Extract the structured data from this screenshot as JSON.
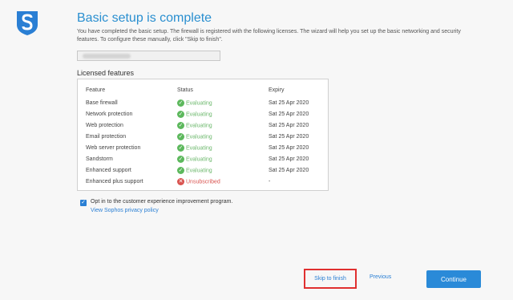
{
  "header": {
    "title": "Basic setup is complete",
    "intro": "You have completed the basic setup. The firewall is registered with the following licenses. The wizard will help you set up the basic networking and security features. To configure these manually, click \"Skip to finish\"."
  },
  "hostname": {
    "value": ""
  },
  "licenses": {
    "heading": "Licensed features",
    "columns": {
      "feature": "Feature",
      "status": "Status",
      "expiry": "Expiry"
    },
    "rows": [
      {
        "feature": "Base firewall",
        "status": "Evaluating",
        "expiry": "Sat 25 Apr 2020"
      },
      {
        "feature": "Network protection",
        "status": "Evaluating",
        "expiry": "Sat 25 Apr 2020"
      },
      {
        "feature": "Web protection",
        "status": "Evaluating",
        "expiry": "Sat 25 Apr 2020"
      },
      {
        "feature": "Email protection",
        "status": "Evaluating",
        "expiry": "Sat 25 Apr 2020"
      },
      {
        "feature": "Web server protection",
        "status": "Evaluating",
        "expiry": "Sat 25 Apr 2020"
      },
      {
        "feature": "Sandstorm",
        "status": "Evaluating",
        "expiry": "Sat 25 Apr 2020"
      },
      {
        "feature": "Enhanced support",
        "status": "Evaluating",
        "expiry": "Sat 25 Apr 2020"
      },
      {
        "feature": "Enhanced plus support",
        "status": "Unsubscribed",
        "expiry": "-"
      }
    ]
  },
  "optin": {
    "checked": true,
    "label": "Opt in to the customer experience improvement program.",
    "privacy_link": "View Sophos privacy policy"
  },
  "footer": {
    "skip_label": "Skip to finish",
    "previous_label": "Previous",
    "continue_label": "Continue"
  },
  "colors": {
    "accent": "#2a8fd0",
    "evaluating": "#5cb85c",
    "unsubscribed": "#d9534f",
    "highlight_border": "#e03030"
  }
}
